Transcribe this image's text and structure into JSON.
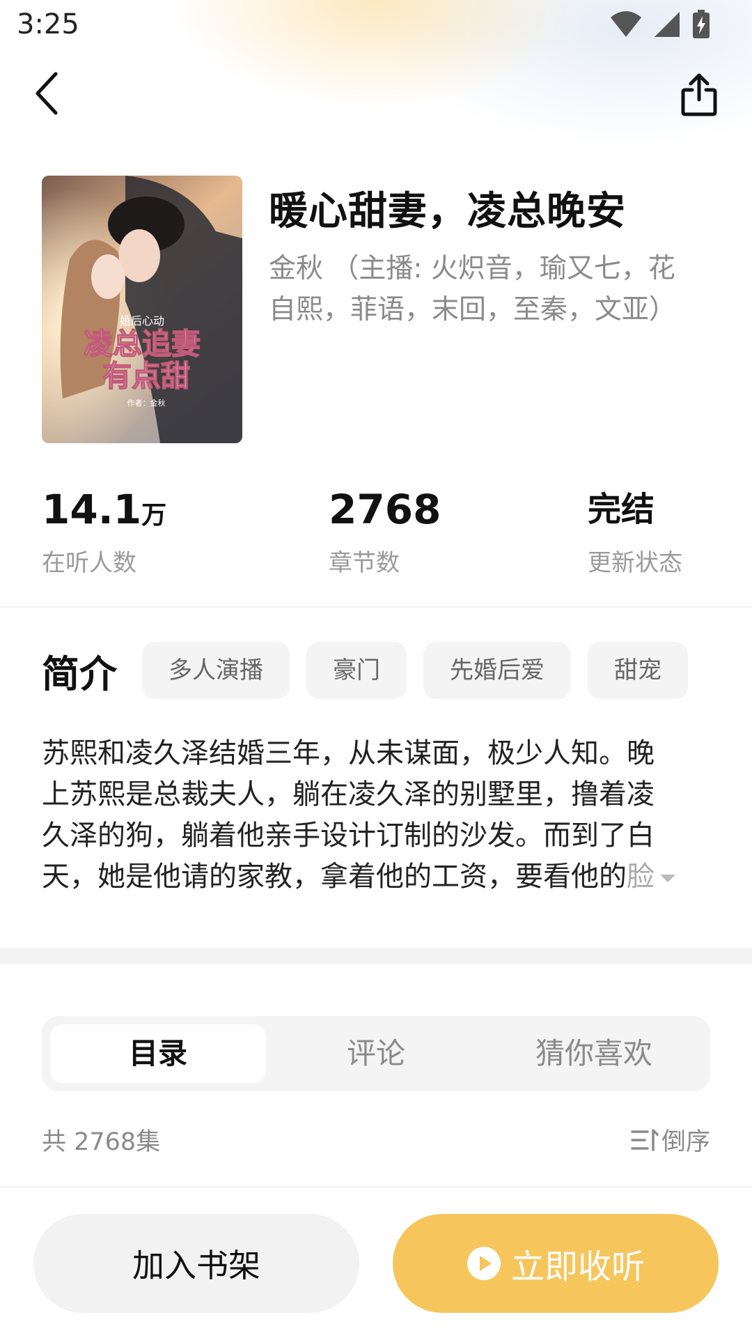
{
  "status_bar": {
    "time": "3:25"
  },
  "book": {
    "title": "暖心甜妻，凌总晚安",
    "author_line_1": "金秋 （主播: 火炽音，瑜又七，花",
    "author_line_2": "自熙，菲语，末回，至秦，文亚）",
    "cover": {
      "tag": "婚后心动",
      "title_line_1": "凌总追妻",
      "title_line_2": "有点甜",
      "byline": "作者：金秋"
    }
  },
  "stats": [
    {
      "value": "14.1",
      "unit": "万",
      "label": "在听人数"
    },
    {
      "value": "2768",
      "unit": "",
      "label": "章节数"
    },
    {
      "value": "完结",
      "unit": "",
      "label": "更新状态"
    }
  ],
  "intro": {
    "title": "简介",
    "tags": [
      "多人演播",
      "豪门",
      "先婚后爱",
      "甜宠"
    ],
    "lines": [
      "苏熙和凌久泽结婚三年，从未谋面，极少人知。晚",
      "上苏熙是总裁夫人，躺在凌久泽的别墅里，撸着凌",
      "久泽的狗，躺着他亲手设计订制的沙发。而到了白",
      "天，她是他请的家教，拿着他的工资，要看他的"
    ],
    "fade_text": "脸"
  },
  "tabs": [
    {
      "label": "目录",
      "active": true
    },
    {
      "label": "评论",
      "active": false
    },
    {
      "label": "猜你喜欢",
      "active": false
    }
  ],
  "catalog": {
    "count_text": "共 2768集",
    "sort_label": "倒序"
  },
  "actions": {
    "shelf_label": "加入书架",
    "listen_label": "立即收听"
  },
  "colors": {
    "accent": "#f6c55c",
    "tag_bg": "#f4f4f4",
    "muted_text": "#8a8a8a"
  }
}
